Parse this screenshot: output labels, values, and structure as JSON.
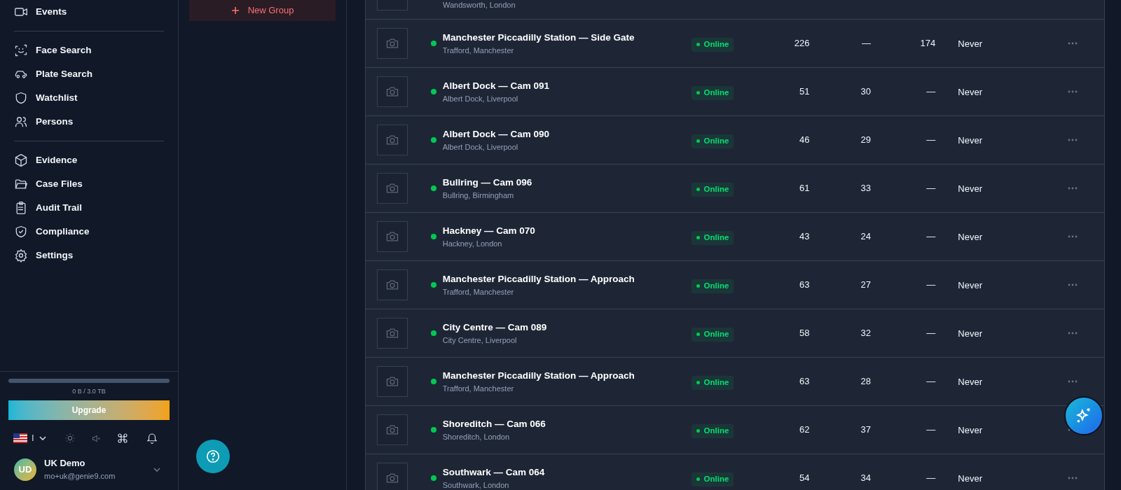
{
  "sidebar": {
    "sections": [
      {
        "items": [
          {
            "label": "Events",
            "kind": "video"
          }
        ]
      },
      {
        "items": [
          {
            "label": "Face Search",
            "kind": "face"
          },
          {
            "label": "Plate Search",
            "kind": "car"
          },
          {
            "label": "Watchlist",
            "kind": "shield"
          },
          {
            "label": "Persons",
            "kind": "users"
          }
        ]
      },
      {
        "items": [
          {
            "label": "Evidence",
            "kind": "box"
          },
          {
            "label": "Case Files",
            "kind": "folder"
          },
          {
            "label": "Audit Trail",
            "kind": "clipboard"
          },
          {
            "label": "Compliance",
            "kind": "shield-check"
          },
          {
            "label": "Settings",
            "kind": "gear"
          }
        ]
      }
    ],
    "storage": {
      "label": "0 B / 3.0 TB",
      "level": 0
    },
    "upgrade_button": "Upgrade",
    "language_code": "I",
    "user": {
      "initials": "UD",
      "name": "UK Demo",
      "email": "mo+uk@genie9.com"
    }
  },
  "groups": {
    "new_group_button": "New Group"
  },
  "cameras": [
    {
      "subtitle": "Wandsworth, London",
      "partial": true
    },
    {
      "title": "Manchester Piccadilly Station — Side Gate",
      "subtitle": "Trafford, Manchester",
      "online": true,
      "status": "Online",
      "column_1": "226",
      "column_2": "—",
      "column_3": "174",
      "last": "Never"
    },
    {
      "title": "Albert Dock — Cam 091",
      "subtitle": "Albert Dock, Liverpool",
      "online": true,
      "status": "Online",
      "column_1": "51",
      "column_2": "30",
      "column_3": "—",
      "last": "Never"
    },
    {
      "title": "Albert Dock — Cam 090",
      "subtitle": "Albert Dock, Liverpool",
      "online": true,
      "status": "Online",
      "column_1": "46",
      "column_2": "29",
      "column_3": "—",
      "last": "Never"
    },
    {
      "title": "Bullring — Cam 096",
      "subtitle": "Bullring, Birmingham",
      "online": true,
      "status": "Online",
      "column_1": "61",
      "column_2": "33",
      "column_3": "—",
      "last": "Never"
    },
    {
      "title": "Hackney — Cam 070",
      "subtitle": "Hackney, London",
      "online": true,
      "status": "Online",
      "column_1": "43",
      "column_2": "24",
      "column_3": "—",
      "last": "Never"
    },
    {
      "title": "Manchester Piccadilly Station — Approach",
      "subtitle": "Trafford, Manchester",
      "online": true,
      "status": "Online",
      "column_1": "63",
      "column_2": "27",
      "column_3": "—",
      "last": "Never"
    },
    {
      "title": "City Centre — Cam 089",
      "subtitle": "City Centre, Liverpool",
      "online": true,
      "status": "Online",
      "column_1": "58",
      "column_2": "32",
      "column_3": "—",
      "last": "Never"
    },
    {
      "title": "Manchester Piccadilly Station — Approach",
      "subtitle": "Trafford, Manchester",
      "online": true,
      "status": "Online",
      "column_1": "63",
      "column_2": "28",
      "column_3": "—",
      "last": "Never"
    },
    {
      "title": "Shoreditch — Cam 066",
      "subtitle": "Shoreditch, London",
      "online": true,
      "status": "Online",
      "column_1": "62",
      "column_2": "37",
      "column_3": "—",
      "last": "Never"
    },
    {
      "title": "Southwark — Cam 064",
      "subtitle": "Southwark, London",
      "online": true,
      "status": "Online",
      "column_1": "54",
      "column_2": "34",
      "column_3": "—",
      "last": "Never"
    }
  ]
}
